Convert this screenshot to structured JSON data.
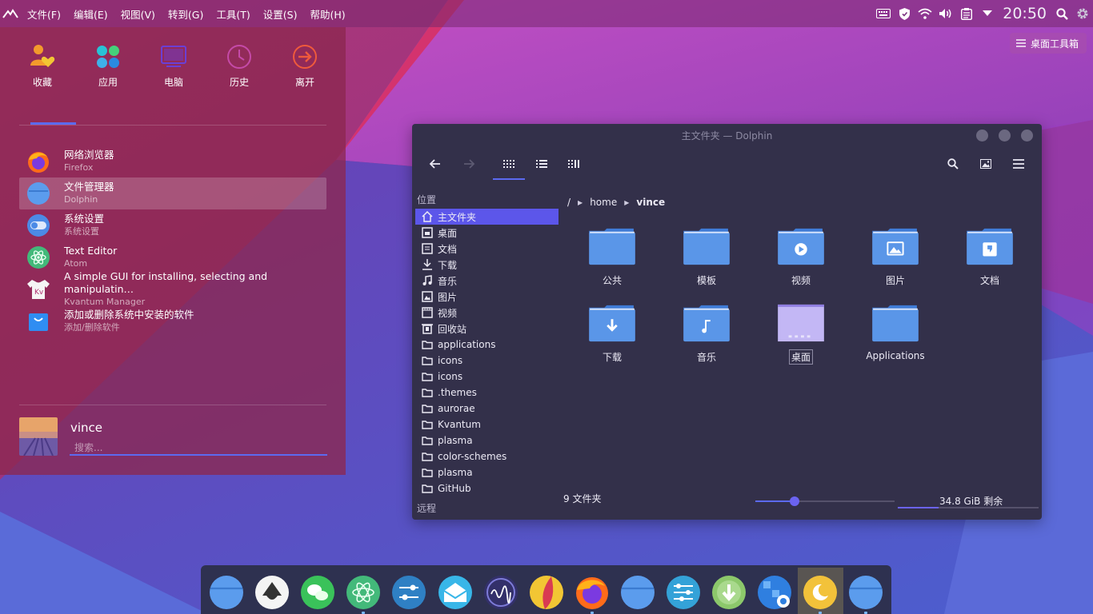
{
  "top_panel": {
    "menus": [
      "文件(F)",
      "编辑(E)",
      "视图(V)",
      "转到(G)",
      "工具(T)",
      "设置(S)",
      "帮助(H)"
    ],
    "clock": "20:50",
    "tray_icons": [
      "keyboard-icon",
      "shield-icon",
      "wifi-icon",
      "volume-icon",
      "clipboard-icon",
      "arrow-down-icon",
      "search-icon",
      "gear-icon"
    ]
  },
  "desktop_toolbox": {
    "label": "桌面工具箱"
  },
  "launcher": {
    "tabs": [
      {
        "label": "收藏",
        "icon": "favorites-icon"
      },
      {
        "label": "应用",
        "icon": "apps-icon"
      },
      {
        "label": "电脑",
        "icon": "computer-icon"
      },
      {
        "label": "历史",
        "icon": "history-icon"
      },
      {
        "label": "离开",
        "icon": "leave-icon"
      }
    ],
    "apps": [
      {
        "title": "网络浏览器",
        "subtitle": "Firefox",
        "icon": "firefox-icon"
      },
      {
        "title": "文件管理器",
        "subtitle": "Dolphin",
        "icon": "dolphin-icon"
      },
      {
        "title": "系统设置",
        "subtitle": "系统设置",
        "icon": "settings-icon"
      },
      {
        "title": "Text Editor",
        "subtitle": "Atom",
        "icon": "atom-icon"
      },
      {
        "title": "A simple GUI for installing, selecting and manipulatin…",
        "subtitle": "Kvantum Manager",
        "icon": "kvantum-icon"
      },
      {
        "title": "添加或删除系统中安装的软件",
        "subtitle": "添加/删除软件",
        "icon": "software-icon"
      }
    ],
    "user": {
      "name": "vince",
      "search_placeholder": "搜索..."
    }
  },
  "dolphin": {
    "title": "主文件夹 — Dolphin",
    "places_header": "位置",
    "remote_header": "远程",
    "places": [
      {
        "label": "主文件夹",
        "icon": "home-icon"
      },
      {
        "label": "桌面",
        "icon": "desktop-icon"
      },
      {
        "label": "文档",
        "icon": "document-icon"
      },
      {
        "label": "下载",
        "icon": "download-icon"
      },
      {
        "label": "音乐",
        "icon": "music-icon"
      },
      {
        "label": "图片",
        "icon": "picture-icon"
      },
      {
        "label": "视频",
        "icon": "video-icon"
      },
      {
        "label": "回收站",
        "icon": "trash-icon"
      },
      {
        "label": "applications",
        "icon": "folder-icon"
      },
      {
        "label": "icons",
        "icon": "folder-icon"
      },
      {
        "label": "icons",
        "icon": "folder-icon"
      },
      {
        "label": ".themes",
        "icon": "folder-icon"
      },
      {
        "label": "aurorae",
        "icon": "folder-icon"
      },
      {
        "label": "Kvantum",
        "icon": "folder-icon"
      },
      {
        "label": "plasma",
        "icon": "folder-icon"
      },
      {
        "label": "color-schemes",
        "icon": "folder-icon"
      },
      {
        "label": "plasma",
        "icon": "folder-icon"
      },
      {
        "label": "GitHub",
        "icon": "folder-icon"
      }
    ],
    "breadcrumb": [
      "/",
      "home",
      "vince"
    ],
    "files": [
      {
        "label": "公共",
        "icon": "folder-icon"
      },
      {
        "label": "模板",
        "icon": "folder-icon"
      },
      {
        "label": "视频",
        "icon": "folder-video-icon"
      },
      {
        "label": "图片",
        "icon": "folder-picture-icon"
      },
      {
        "label": "文档",
        "icon": "folder-document-icon"
      },
      {
        "label": "下载",
        "icon": "folder-download-icon"
      },
      {
        "label": "音乐",
        "icon": "folder-music-icon"
      },
      {
        "label": "桌面",
        "icon": "folder-desktop-icon"
      },
      {
        "label": "Applications",
        "icon": "folder-icon"
      }
    ],
    "status": {
      "count": "9 文件夹",
      "free": "34.8 GiB 剩余",
      "zoom_fraction": 0.28,
      "used_fraction": 0.29
    }
  },
  "dock": {
    "apps": [
      {
        "name": "dolphin-icon"
      },
      {
        "name": "inkscape-icon"
      },
      {
        "name": "wechat-icon"
      },
      {
        "name": "atom-icon"
      },
      {
        "name": "settings-icon"
      },
      {
        "name": "mail-icon"
      },
      {
        "name": "monitor-icon"
      },
      {
        "name": "ball-icon"
      },
      {
        "name": "firefox-icon"
      },
      {
        "name": "dolphin-icon"
      },
      {
        "name": "settings-sliders-icon"
      },
      {
        "name": "download-icon"
      },
      {
        "name": "discover-icon"
      },
      {
        "name": "moon-icon"
      },
      {
        "name": "dolphin-icon"
      }
    ],
    "colors": {
      "accent": "#5c6af0",
      "folder": "#5a96e8"
    }
  }
}
